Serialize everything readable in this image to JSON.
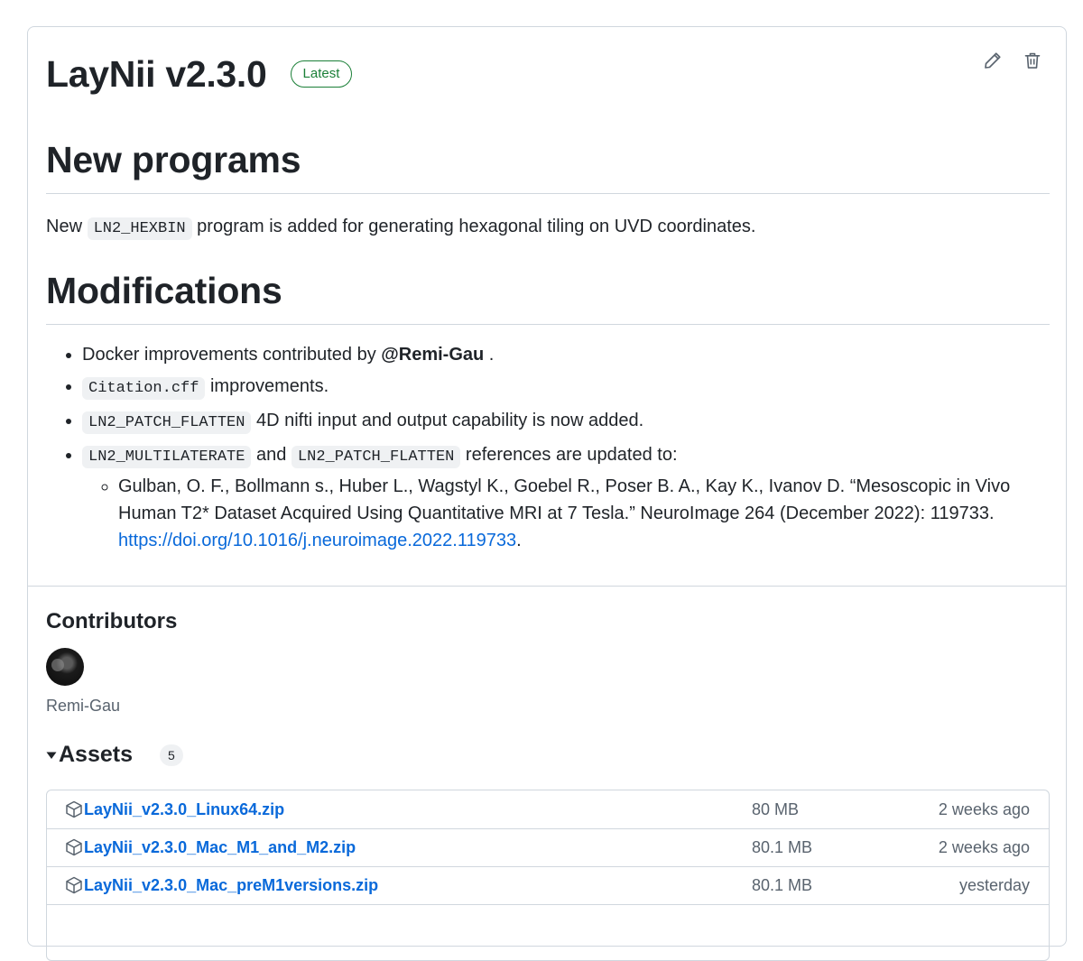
{
  "release": {
    "title": "LayNii v2.3.0",
    "badge": "Latest"
  },
  "icons": {
    "edit": "pencil-icon",
    "delete": "trash-icon",
    "asset": "package-icon",
    "toggle": "triangle-down-icon"
  },
  "sections": {
    "new_programs": {
      "heading": "New programs",
      "pre": "New ",
      "code": "LN2_HEXBIN",
      "post": " program is added for generating hexagonal tiling on UVD coordinates."
    },
    "modifications": {
      "heading": "Modifications",
      "item1_text": "Docker improvements contributed by ",
      "item1_mention": "@Remi-Gau",
      "item1_end": " .",
      "item2_code": "Citation.cff",
      "item2_text": " improvements.",
      "item3_code": "LN2_PATCH_FLATTEN",
      "item3_text": " 4D nifti input and output capability is now added.",
      "item4_code1": "LN2_MULTILATERATE",
      "item4_mid": " and ",
      "item4_code2": "LN2_PATCH_FLATTEN",
      "item4_text": " references are updated to:",
      "citation": "Gulban, O. F., Bollmann s., Huber L., Wagstyl K., Goebel R., Poser B. A., Kay K., Ivanov D. “Mesoscopic in Vivo Human T2* Dataset Acquired Using Quantitative MRI at 7 Tesla.” NeuroImage 264 (December 2022): 119733. ",
      "citation_link": "https://doi.org/10.1016/j.neuroimage.2022.119733",
      "citation_end": "."
    }
  },
  "contributors": {
    "heading": "Contributors",
    "name": "Remi-Gau"
  },
  "assets": {
    "heading": "Assets",
    "count": "5",
    "rows": [
      {
        "name": "LayNii_v2.3.0_Linux64.zip",
        "size": "80 MB",
        "date": "2 weeks ago"
      },
      {
        "name": "LayNii_v2.3.0_Mac_M1_and_M2.zip",
        "size": "80.1 MB",
        "date": "2 weeks ago"
      },
      {
        "name": "LayNii_v2.3.0_Mac_preM1versions.zip",
        "size": "80.1 MB",
        "date": "yesterday"
      }
    ]
  }
}
